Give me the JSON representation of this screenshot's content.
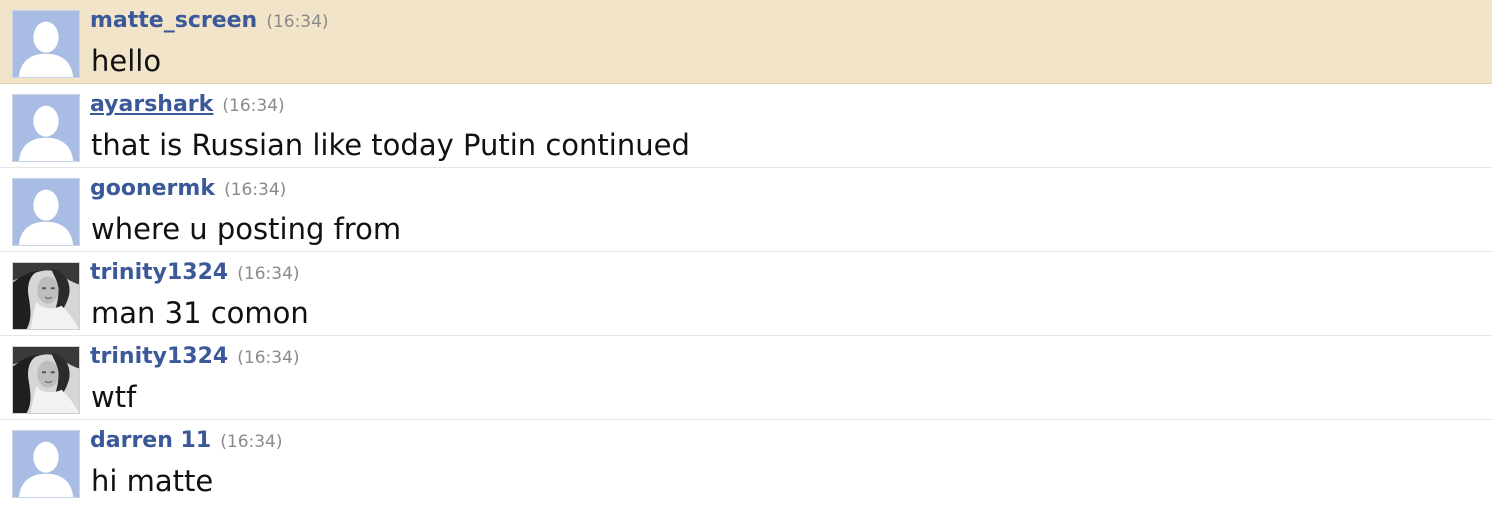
{
  "messages": [
    {
      "user": "matte_screen",
      "time": "(16:34)",
      "text": "hello",
      "avatar": "default-avatar-icon",
      "highlighted": true
    },
    {
      "user": "ayarshark",
      "time": "(16:34)",
      "text": "that is Russian like today Putin continued",
      "avatar": "default-avatar-icon",
      "underlined": true
    },
    {
      "user": "goonermk",
      "time": "(16:34)",
      "text": "where u posting from",
      "avatar": "default-avatar-icon"
    },
    {
      "user": "trinity1324",
      "time": "(16:34)",
      "text": "man 31 comon",
      "avatar": "photo-avatar"
    },
    {
      "user": "trinity1324",
      "time": "(16:34)",
      "text": "wtf",
      "avatar": "photo-avatar"
    },
    {
      "user": "darren 11",
      "time": "(16:34)",
      "text": "hi matte",
      "avatar": "default-avatar-icon"
    }
  ],
  "colors": {
    "highlight_bg": "#f1e4c8",
    "username": "#3b5998",
    "timestamp": "#8a8a8a",
    "default_avatar_bg": "#a9bde4",
    "default_avatar_figure": "#ffffff"
  }
}
